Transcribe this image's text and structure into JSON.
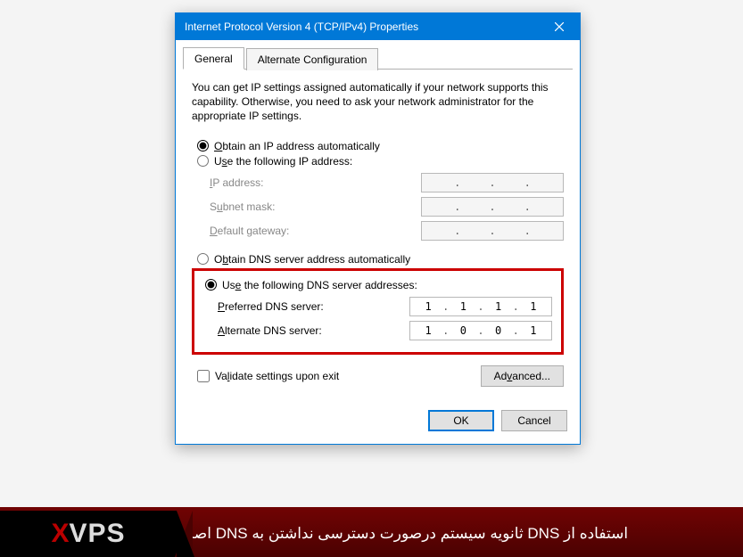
{
  "dialog": {
    "title": "Internet Protocol Version 4 (TCP/IPv4) Properties",
    "tabs": [
      "General",
      "Alternate Configuration"
    ],
    "intro": "You can get IP settings assigned automatically if your network supports this capability. Otherwise, you need to ask your network administrator for the appropriate IP settings.",
    "ip": {
      "auto_label": "btain an IP address automatically",
      "manual_label": "e the following IP address:",
      "fields": {
        "address": "P address:",
        "subnet": "bnet mask:",
        "gateway": "efault gateway:"
      }
    },
    "dns": {
      "auto_label": "tain DNS server address automatically",
      "manual_label": " the following DNS server addresses:",
      "fields": {
        "preferred": "referred DNS server:",
        "alternate": "lternate DNS server:"
      },
      "preferred_value": [
        "1",
        "1",
        "1",
        "1"
      ],
      "alternate_value": [
        "1",
        "0",
        "0",
        "1"
      ]
    },
    "validate_label": "idate settings upon exit",
    "advanced_label": "anced...",
    "ok_label": "OK",
    "cancel_label": "Cancel"
  },
  "branding": {
    "logo_x": "X",
    "logo_vps": "VPS",
    "caption": "استفاده از DNS ثانویه سیستم درصورت دسترسی نداشتن به DNS اصلی"
  }
}
